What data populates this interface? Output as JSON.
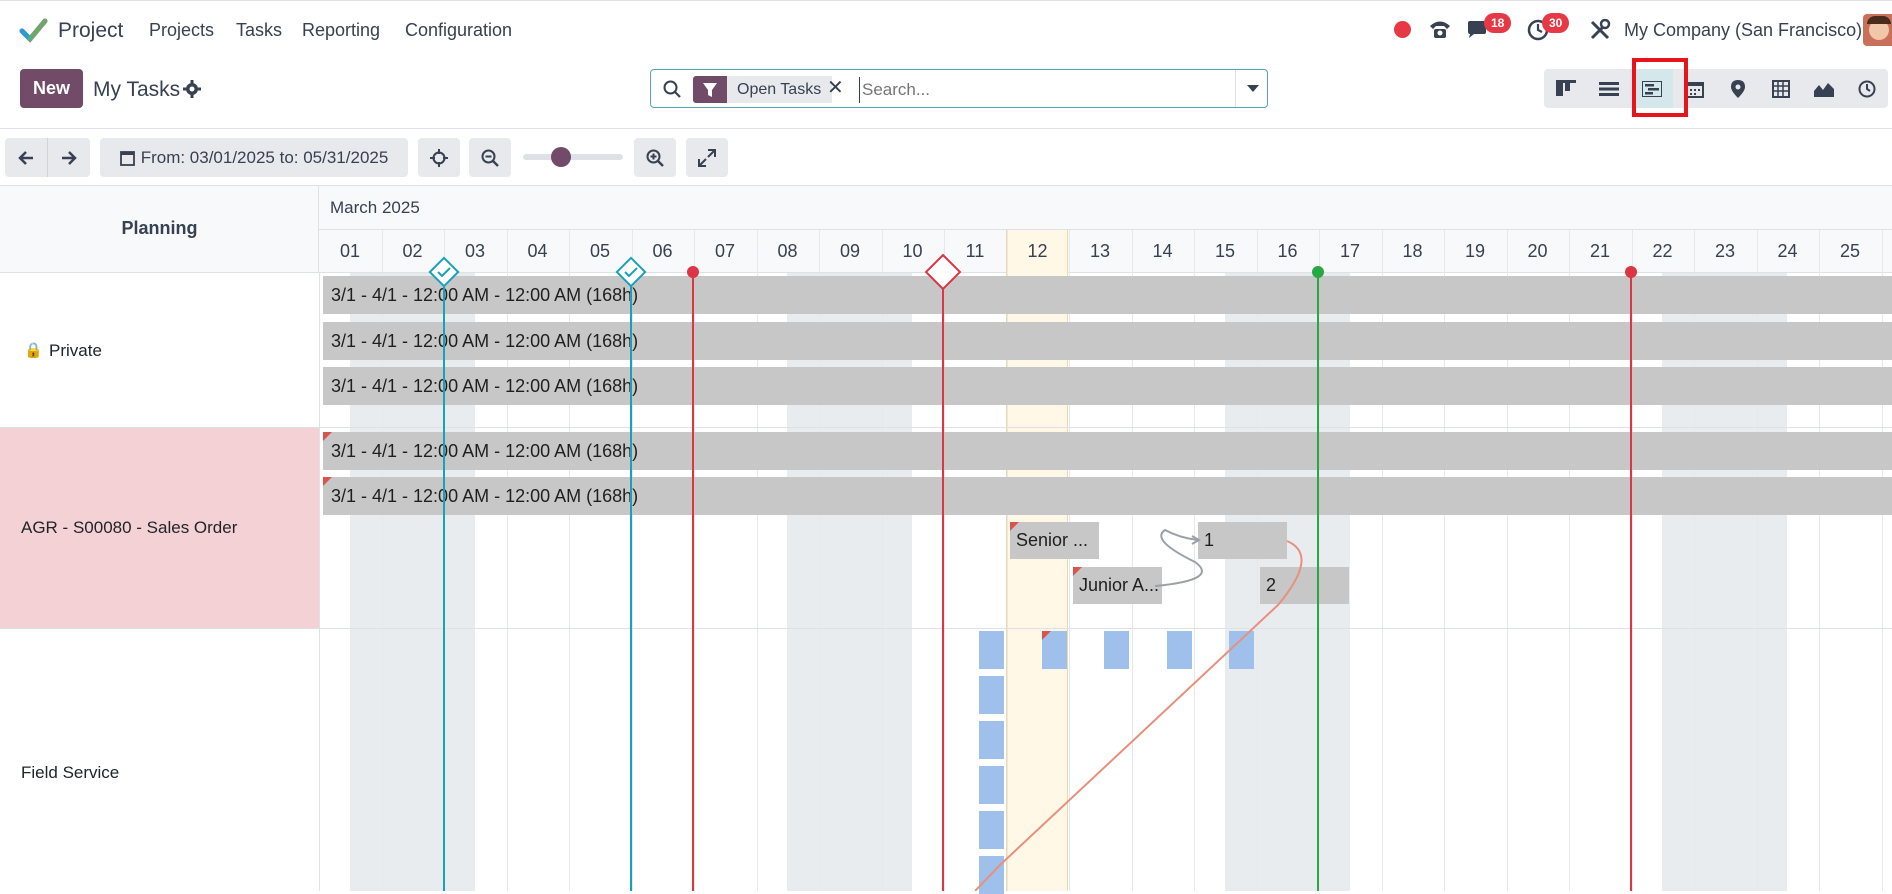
{
  "app": {
    "name": "Project"
  },
  "nav": {
    "menu": [
      "Projects",
      "Tasks",
      "Reporting",
      "Configuration"
    ],
    "messages_count": "18",
    "activities_count": "30",
    "company": "My Company (San Francisco)"
  },
  "control": {
    "new_label": "New",
    "title": "My Tasks",
    "facet": "Open Tasks",
    "search_placeholder": "Search..."
  },
  "views": [
    "kanban-icon",
    "list-icon",
    "gantt-icon",
    "calendar-icon",
    "map-icon",
    "pivot-icon",
    "graph-icon",
    "activity-icon"
  ],
  "toolbar": {
    "date_range": "From: 03/01/2025 to: 05/31/2025",
    "zoom_level": 0.35
  },
  "gantt": {
    "header_left": "Planning",
    "month": "March 2025",
    "days": [
      "01",
      "02",
      "03",
      "04",
      "05",
      "06",
      "07",
      "08",
      "09",
      "10",
      "11",
      "12",
      "13",
      "14",
      "15",
      "16",
      "17",
      "18",
      "19",
      "20",
      "21",
      "22",
      "23",
      "24",
      "25"
    ],
    "rows": [
      {
        "label": "Private",
        "bars": [
          "3/1 - 4/1 - 12:00 AM - 12:00 AM (168h)",
          "3/1 - 4/1 - 12:00 AM - 12:00 AM (168h)",
          "3/1 - 4/1 - 12:00 AM - 12:00 AM (168h)"
        ]
      },
      {
        "label": "AGR - S00080 - Sales Order",
        "bars": [
          "3/1 - 4/1 - 12:00 AM - 12:00 AM (168h)",
          "3/1 - 4/1 - 12:00 AM - 12:00 AM (168h)"
        ],
        "small_bars": [
          "Senior ...",
          "Junior A...",
          "1",
          "2"
        ]
      },
      {
        "label": "Field Service"
      }
    ]
  },
  "colors": {
    "primary": "#714b67",
    "accent": "#017e84",
    "danger": "#d9534f",
    "success": "#28a745"
  }
}
